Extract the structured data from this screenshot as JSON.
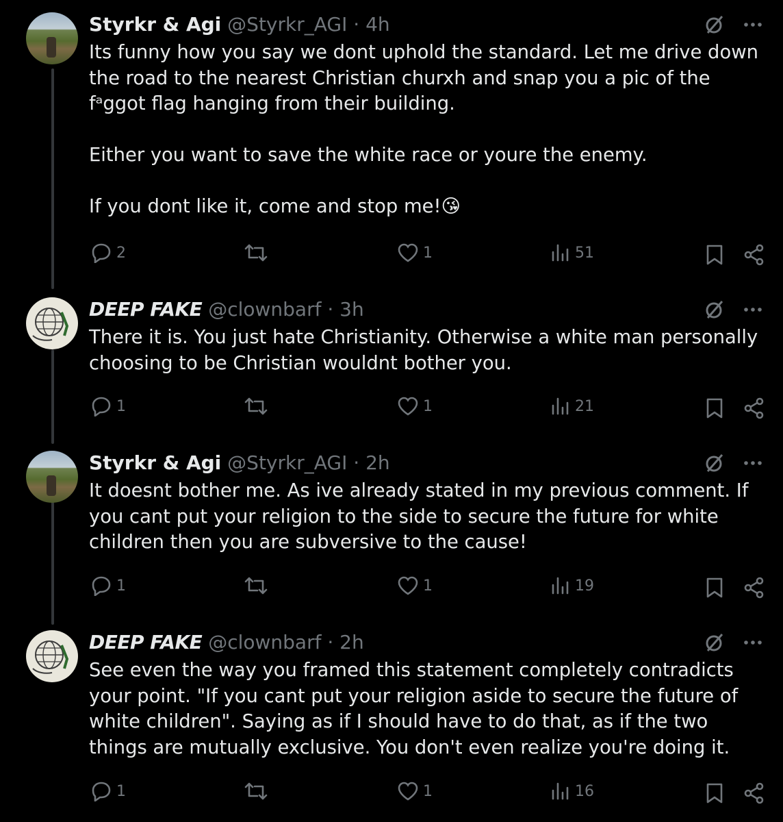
{
  "posts": [
    {
      "name": "Styrkr & Agi",
      "handle": "@Styrkr_AGI",
      "sep": "·",
      "time": "4h",
      "text": "Its funny how you say we dont uphold the standard. Let me drive down the road to the nearest Christian churxh and snap you a pic of the fᵃggot flag hanging from their building.\n\nEither you want to save the white race or youre the enemy.\n\nIf you dont like it, come and stop me!😘",
      "replies": "2",
      "likes": "1",
      "views": "51",
      "avatar": "landscape"
    },
    {
      "name": "DEEP FAKE",
      "handle": "@clownbarf",
      "sep": "·",
      "time": "3h",
      "text": "There it is. You just hate Christianity. Otherwise a white man personally choosing to be Christian wouldnt bother you.",
      "replies": "1",
      "likes": "1",
      "views": "21",
      "avatar": "sketch"
    },
    {
      "name": "Styrkr & Agi",
      "handle": "@Styrkr_AGI",
      "sep": "·",
      "time": "2h",
      "text": "It doesnt bother me. As ive already stated in my previous comment. If you cant put your religion to the side to secure the future for white children then you are subversive to the cause!",
      "replies": "1",
      "likes": "1",
      "views": "19",
      "avatar": "landscape"
    },
    {
      "name": "DEEP FAKE",
      "handle": "@clownbarf",
      "sep": "·",
      "time": "2h",
      "text": "See even the way you framed this statement completely contradicts your point. \"If you cant put your religion aside to secure the future of white children\". Saying as if I should have to do that, as if the two things are mutually exclusive. You don't even realize you're doing it.",
      "replies": "1",
      "likes": "1",
      "views": "16",
      "avatar": "sketch"
    }
  ]
}
